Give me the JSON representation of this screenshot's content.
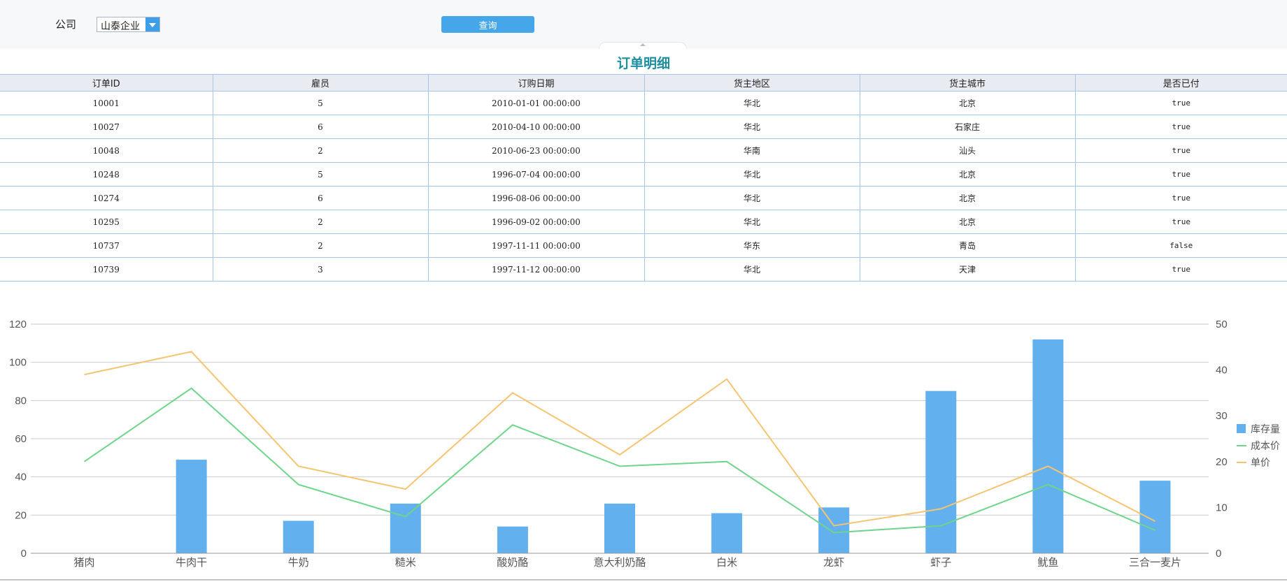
{
  "toolbar": {
    "company_label": "公司",
    "company_value": "山泰企业",
    "query_label": "查询"
  },
  "report": {
    "title": "订单明细",
    "columns": [
      "订单ID",
      "雇员",
      "订购日期",
      "货主地区",
      "货主城市",
      "是否已付"
    ],
    "rows": [
      [
        "10001",
        "5",
        "2010-01-01 00:00:00",
        "华北",
        "北京",
        "true"
      ],
      [
        "10027",
        "6",
        "2010-04-10 00:00:00",
        "华北",
        "石家庄",
        "true"
      ],
      [
        "10048",
        "2",
        "2010-06-23 00:00:00",
        "华南",
        "汕头",
        "true"
      ],
      [
        "10248",
        "5",
        "1996-07-04 00:00:00",
        "华北",
        "北京",
        "true"
      ],
      [
        "10274",
        "6",
        "1996-08-06 00:00:00",
        "华北",
        "北京",
        "true"
      ],
      [
        "10295",
        "2",
        "1996-09-02 00:00:00",
        "华北",
        "北京",
        "true"
      ],
      [
        "10737",
        "2",
        "1997-11-11 00:00:00",
        "华东",
        "青岛",
        "false"
      ],
      [
        "10739",
        "3",
        "1997-11-12 00:00:00",
        "华北",
        "天津",
        "true"
      ]
    ]
  },
  "chart_data": {
    "type": "bar",
    "categories": [
      "猪肉",
      "牛肉干",
      "牛奶",
      "糙米",
      "酸奶酪",
      "意大利奶酪",
      "白米",
      "龙虾",
      "虾子",
      "鱿鱼",
      "三合一麦片"
    ],
    "series": [
      {
        "name": "库存量",
        "type": "bar",
        "axis": "left",
        "color": "#62b0ee",
        "values": [
          0,
          49,
          17,
          26,
          14,
          26,
          21,
          24,
          85,
          112,
          38
        ]
      },
      {
        "name": "成本价",
        "type": "line",
        "axis": "right",
        "color": "#6ed58a",
        "values": [
          20,
          36,
          15,
          8,
          28,
          19,
          20,
          4.5,
          6,
          15,
          5
        ]
      },
      {
        "name": "单价",
        "type": "line",
        "axis": "right",
        "color": "#f6c471",
        "values": [
          39,
          44,
          19,
          14,
          35,
          21.5,
          38,
          6,
          9.7,
          19,
          7
        ]
      }
    ],
    "ylim": [
      0,
      120
    ],
    "yticks": [
      0,
      20,
      40,
      60,
      80,
      100,
      120
    ],
    "y2lim": [
      0,
      50
    ],
    "y2ticks": [
      0,
      10,
      20,
      30,
      40,
      50
    ],
    "grid": true,
    "legend_position": "right",
    "colors": {
      "grid": "#cccccc",
      "axis_text": "#555555"
    }
  }
}
